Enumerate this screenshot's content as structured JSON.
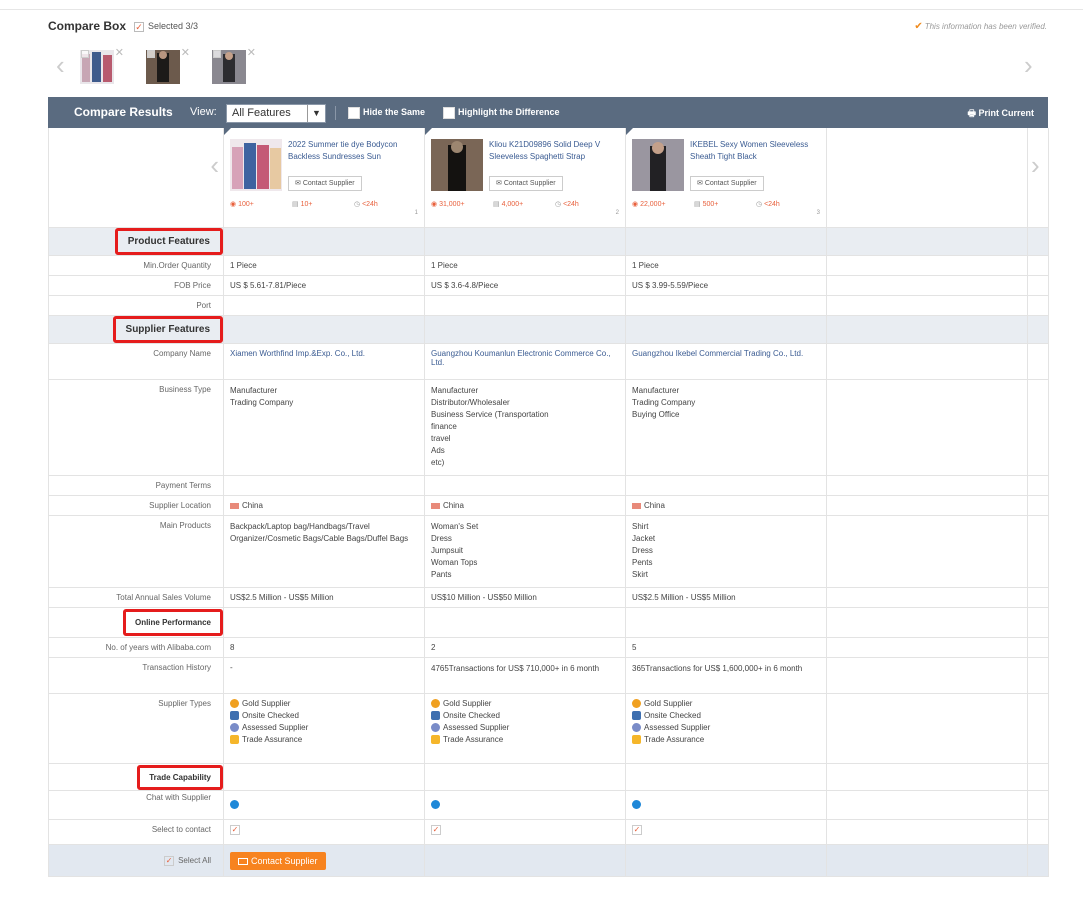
{
  "compare_box": {
    "title": "Compare Box",
    "selected": "Selected 3/3",
    "verified": "This information has been verified.",
    "thumbs": [
      {
        "img_colors": [
          "#c7a6b4",
          "#3e5b8c",
          "#b85a6e"
        ]
      },
      {
        "img_colors": [
          "#2b2622",
          "#6c5a4c",
          "#1c1a18"
        ]
      },
      {
        "img_colors": [
          "#4a4a4e",
          "#8a8890",
          "#2c2c30"
        ]
      }
    ]
  },
  "results": {
    "title": "Compare Results",
    "view_label": "View:",
    "view_value": "All Features",
    "hide_same": "Hide the Same",
    "highlight_diff": "Highlight the Difference",
    "print": "Print Current"
  },
  "products": [
    {
      "title": "2022 Summer tie dye Bodycon Backless Sundresses Sun",
      "contact": "Contact Supplier",
      "views": "100+",
      "orders": "10+",
      "reply": "<24h",
      "num": "1",
      "img_colors": [
        "#d7a2b8",
        "#3f63a0",
        "#c45a76",
        "#e7c9a2"
      ]
    },
    {
      "title": "Kliou K21D09896 Solid Deep V Sleeveless Spaghetti Strap",
      "contact": "Contact Supplier",
      "views": "31,000+",
      "orders": "4,000+",
      "reply": "<24h",
      "num": "2",
      "img_colors": [
        "#2a2420",
        "#7a6656",
        "#141210",
        "#9c8670"
      ]
    },
    {
      "title": "IKEBEL Sexy Women Sleeveless Sheath Tight Black",
      "contact": "Contact Supplier",
      "views": "22,000+",
      "orders": "500+",
      "reply": "<24h",
      "num": "3",
      "img_colors": [
        "#3d3b40",
        "#9a96a0",
        "#222124",
        "#6a6870"
      ]
    }
  ],
  "sections": {
    "product": "Product Features",
    "supplier": "Supplier Features",
    "online": "Online Performance",
    "trade": "Trade Capability"
  },
  "labels": {
    "moq": "Min.Order Quantity",
    "fob": "FOB Price",
    "port": "Port",
    "company": "Company Name",
    "business": "Business Type",
    "payment": "Payment Terms",
    "location": "Supplier Location",
    "main_products": "Main Products",
    "sales": "Total Annual Sales Volume",
    "years": "No. of years with Alibaba.com",
    "transactions": "Transaction History",
    "supplier_types": "Supplier Types",
    "chat": "Chat with Supplier",
    "select": "Select to contact",
    "select_all": "Select All",
    "contact_btn": "Contact Supplier"
  },
  "rows": {
    "moq": [
      "1 Piece",
      "1 Piece",
      "1 Piece"
    ],
    "fob": [
      "US $ 5.61-7.81/Piece",
      "US $ 3.6-4.8/Piece",
      "US $ 3.99-5.59/Piece"
    ],
    "company": [
      "Xiamen Worthfind Imp.&Exp. Co., Ltd.",
      "Guangzhou Koumanlun Electronic Commerce Co., Ltd.",
      "Guangzhou Ikebel Commercial Trading Co., Ltd."
    ],
    "business": [
      [
        "Manufacturer",
        "Trading Company"
      ],
      [
        "Manufacturer",
        "Distributor/Wholesaler",
        "Business Service (Transportation",
        "finance",
        "travel",
        "Ads",
        "etc)"
      ],
      [
        "Manufacturer",
        "Trading Company",
        "Buying Office"
      ]
    ],
    "location": [
      "China",
      "China",
      "China"
    ],
    "main_products": [
      [
        "Backpack/Laptop bag/Handbags/Travel Organizer/Cosmetic Bags/Cable Bags/Duffel Bags"
      ],
      [
        "Woman's Set",
        "Dress",
        "Jumpsuit",
        "Woman Tops",
        "Pants"
      ],
      [
        "Shirt",
        "Jacket",
        "Dress",
        "Pents",
        "Skirt"
      ]
    ],
    "sales": [
      "US$2.5 Million - US$5 Million",
      "US$10 Million - US$50 Million",
      "US$2.5 Million - US$5 Million"
    ],
    "years": [
      "8",
      "2",
      "5"
    ],
    "transactions": [
      "-",
      "4765Transactions for US$ 710,000+ in 6 month",
      "365Transactions for US$ 1,600,000+ in 6 month"
    ],
    "supplier_types": [
      "Gold Supplier",
      "Onsite Checked",
      "Assessed Supplier",
      "Trade Assurance"
    ]
  },
  "colors": {
    "bar": "#5a6b80",
    "section_bg": "#e9edf2",
    "highlight_border": "#e51c1c",
    "accent": "#f7831f",
    "link": "#3a5b92"
  }
}
